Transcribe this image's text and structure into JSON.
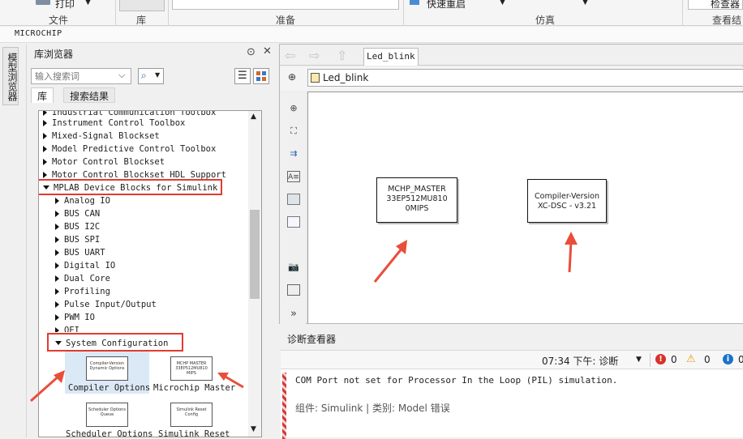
{
  "ribbon": {
    "print_label": "打印",
    "quick_restart_label": "快速重启",
    "check_label": "检查器",
    "groups": {
      "file": "文件",
      "library": "库",
      "prepare": "准备",
      "simulation": "仿真",
      "review": "查看结"
    }
  },
  "path_bar": {
    "text": "MICROCHIP"
  },
  "side_tab": {
    "label": "模型浏览器"
  },
  "library_browser": {
    "title": "库浏览器",
    "search_placeholder": "输入搜索词",
    "tabs": [
      "库",
      "搜索结果"
    ],
    "tree_items": [
      "Industrial Communication Toolbox",
      "Instrument Control Toolbox",
      "Mixed-Signal Blockset",
      "Model Predictive Control Toolbox",
      "Motor Control Blockset",
      "Motor Control Blockset HDL Support",
      "MPLAB Device Blocks for Simulink",
      "Analog IO",
      "BUS CAN",
      "BUS I2C",
      "BUS SPI",
      "BUS UART",
      "Digital IO",
      "Dual Core",
      "Profiling",
      "Pulse Input/Output",
      "PWM IO",
      "QEI",
      "System Configuration"
    ],
    "blocks": [
      {
        "label": "Compiler Options",
        "inner": "Compiler-Version Dynamic Options"
      },
      {
        "label": "Microchip Master",
        "inner": "MCHP MASTER 33EP512MU810 MIPS"
      },
      {
        "label": "Scheduler Options",
        "inner": "Scheduler Options Queue"
      },
      {
        "label": "Simulink Reset",
        "inner": "Simulink Reset Config"
      }
    ]
  },
  "editor": {
    "tab_label": "Led_blink",
    "address": "Led_blink",
    "blocks": [
      {
        "line1": "MCHP_MASTER",
        "line2": "33EP512MU810",
        "line3": "0MIPS"
      },
      {
        "line1": "Compiler-Version",
        "line2": "XC-DSC - v3.21"
      }
    ]
  },
  "diagnostics": {
    "title": "诊断查看器",
    "time": "07:34 下午: 诊断",
    "errors": "0",
    "warnings": "0",
    "info": "0",
    "message": "COM Port not set for Processor In the Loop (PIL) simulation.",
    "component": "组件: Simulink | 类别: Model 错误"
  },
  "colors": {
    "highlight_red": "#e03c30",
    "accent_blue": "#1a73c8"
  }
}
